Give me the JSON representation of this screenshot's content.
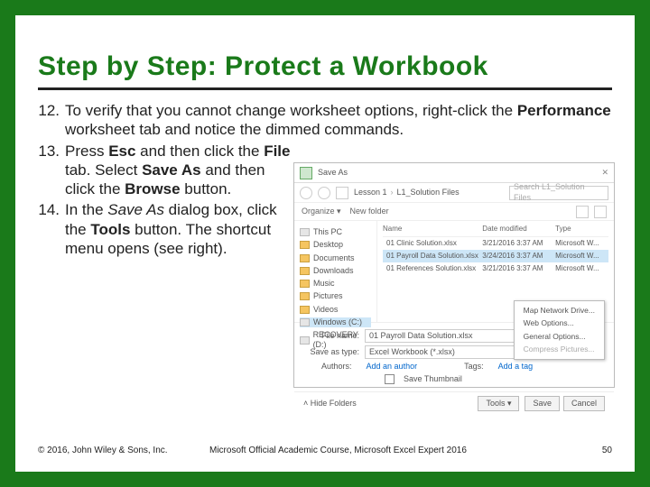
{
  "title": "Step by Step: Protect a Workbook",
  "steps": [
    {
      "num": "12.",
      "html": "To verify that you cannot change worksheet options, right-click the <b>Performance</b> worksheet tab and notice the dimmed commands."
    },
    {
      "num": "13.",
      "html": "Press <b>Esc</b> and then click the <b>File</b> tab. Select <b>Save As</b> and then click the <b>Browse</b> button."
    },
    {
      "num": "14.",
      "html": "In the <i>Save As</i> dialog box, click the <b>Tools</b> button. The shortcut menu opens (see right)."
    }
  ],
  "dialog": {
    "title": "Save As",
    "close": "✕",
    "nav": {
      "crumb1": "Lesson 1",
      "crumb2": "L1_Solution Files",
      "search_placeholder": "Search L1_Solution Files"
    },
    "toolbar": {
      "organize": "Organize ▾",
      "newfolder": "New folder"
    },
    "tree": [
      {
        "label": "This PC",
        "k": "drive"
      },
      {
        "label": "Desktop",
        "k": "folder"
      },
      {
        "label": "Documents",
        "k": "folder"
      },
      {
        "label": "Downloads",
        "k": "folder"
      },
      {
        "label": "Music",
        "k": "folder"
      },
      {
        "label": "Pictures",
        "k": "folder"
      },
      {
        "label": "Videos",
        "k": "folder"
      },
      {
        "label": "Windows (C:)",
        "k": "drive",
        "sel": true
      },
      {
        "label": "RECOVERY (D:)",
        "k": "drive"
      }
    ],
    "columns": {
      "name": "Name",
      "date": "Date modified",
      "type": "Type"
    },
    "files": [
      {
        "name": "01 Clinic Solution.xlsx",
        "date": "3/21/2016 3:37 AM",
        "type": "Microsoft W..."
      },
      {
        "name": "01 Payroll Data Solution.xlsx",
        "date": "3/24/2016 3:37 AM",
        "type": "Microsoft W...",
        "sel": true
      },
      {
        "name": "01 References Solution.xlsx",
        "date": "3/21/2016 3:37 AM",
        "type": "Microsoft W..."
      }
    ],
    "fields": {
      "filename_label": "File name:",
      "filename_value": "01 Payroll Data Solution.xlsx",
      "savetype_label": "Save as type:",
      "savetype_value": "Excel Workbook (*.xlsx)",
      "authors_label": "Authors:",
      "authors_value": "Add an author",
      "tags_label": "Tags:",
      "tags_value": "Add a tag",
      "thumb": "Save Thumbnail"
    },
    "bottom": {
      "hide": "Hide Folders",
      "tools": "Tools ▾",
      "save": "Save",
      "cancel": "Cancel"
    },
    "menu": [
      {
        "label": "Map Network Drive...",
        "dim": false
      },
      {
        "label": "Web Options...",
        "dim": false
      },
      {
        "label": "General Options...",
        "dim": false
      },
      {
        "label": "Compress Pictures...",
        "dim": true
      }
    ]
  },
  "footer": {
    "copy": "© 2016, John Wiley & Sons, Inc.",
    "course": "Microsoft Official Academic Course, Microsoft Excel Expert 2016",
    "page": "50"
  }
}
